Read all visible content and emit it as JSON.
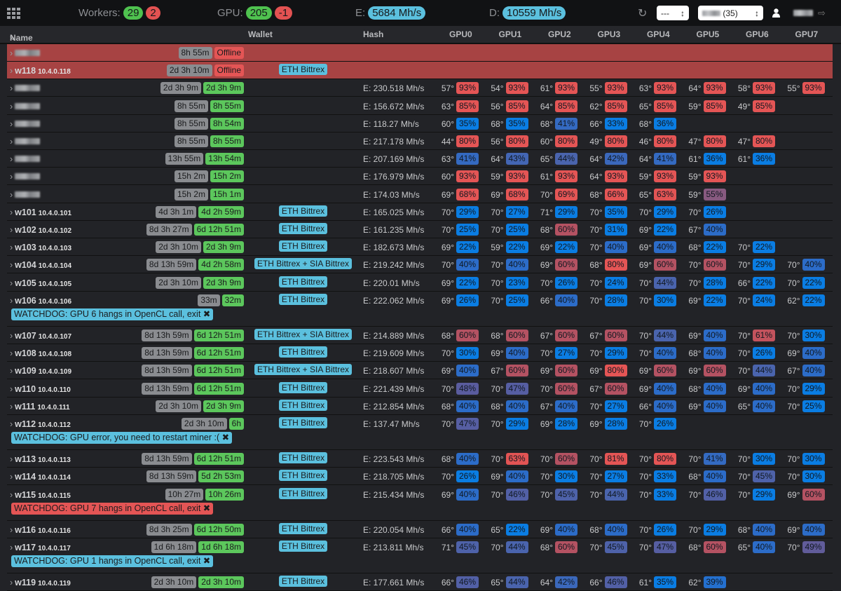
{
  "topbar": {
    "workers_label": "Workers:",
    "workers_ok": "29",
    "workers_bad": "2",
    "gpu_label": "GPU:",
    "gpu_ok": "205",
    "gpu_bad": "-1",
    "e_label": "E:",
    "e_rate": "5684 Mh/s",
    "d_label": "D:",
    "d_rate": "10559 Mh/s",
    "select1": "---",
    "select2": "(35)"
  },
  "columns": {
    "name": "Name",
    "wallet": "Wallet",
    "hash": "Hash",
    "gpus": [
      "GPU0",
      "GPU1",
      "GPU2",
      "GPU3",
      "GPU4",
      "GPU5",
      "GPU6",
      "GPU7"
    ]
  },
  "colors": {
    "offline_row": "#a74343",
    "uptime": "#8a8c90",
    "online": "#5cc75c",
    "offline": "#e45555",
    "wallet": "#5bc0de",
    "fan_low": "#0a7de3",
    "fan_high": "#e45555"
  },
  "rows": [
    {
      "name": "",
      "ip": "",
      "up": "8h 55m",
      "status": "Offline",
      "offline": true,
      "wallet": "",
      "hash": "",
      "gpus": []
    },
    {
      "name": "w118",
      "ip": "10.4.0.118",
      "up": "2d 3h 10m",
      "status": "Offline",
      "offline": true,
      "wallet": "ETH Bittrex",
      "hash": "",
      "gpus": []
    },
    {
      "name": "",
      "ip": "",
      "up": "2d 3h 9m",
      "status": "2d 3h 9m",
      "wallet": "",
      "hash": "E: 230.518 Mh/s",
      "gpus": [
        [
          57,
          93
        ],
        [
          54,
          93
        ],
        [
          61,
          93
        ],
        [
          55,
          93
        ],
        [
          63,
          93
        ],
        [
          64,
          93
        ],
        [
          58,
          93
        ],
        [
          55,
          93
        ]
      ]
    },
    {
      "name": "",
      "ip": "",
      "up": "8h 55m",
      "status": "8h 55m",
      "wallet": "",
      "hash": "E: 156.672 Mh/s",
      "gpus": [
        [
          63,
          85
        ],
        [
          56,
          85
        ],
        [
          64,
          85
        ],
        [
          62,
          85
        ],
        [
          65,
          85
        ],
        [
          59,
          85
        ],
        [
          49,
          85
        ]
      ]
    },
    {
      "name": "",
      "ip": "",
      "up": "8h 55m",
      "status": "8h 54m",
      "wallet": "",
      "hash": "E: 118.27 Mh/s",
      "gpus": [
        [
          60,
          35
        ],
        [
          68,
          35
        ],
        [
          68,
          41
        ],
        [
          66,
          33
        ],
        [
          68,
          36
        ]
      ]
    },
    {
      "name": "",
      "ip": "",
      "up": "8h 55m",
      "status": "8h 55m",
      "wallet": "",
      "hash": "E: 217.178 Mh/s",
      "gpus": [
        [
          44,
          80
        ],
        [
          56,
          80
        ],
        [
          60,
          80
        ],
        [
          49,
          80
        ],
        [
          46,
          80
        ],
        [
          47,
          80
        ],
        [
          47,
          80
        ]
      ]
    },
    {
      "name": "",
      "ip": "",
      "up": "13h 55m",
      "status": "13h 54m",
      "wallet": "",
      "hash": "E: 207.169 Mh/s",
      "gpus": [
        [
          63,
          41
        ],
        [
          64,
          43
        ],
        [
          65,
          44
        ],
        [
          64,
          42
        ],
        [
          64,
          41
        ],
        [
          61,
          36
        ],
        [
          61,
          36
        ]
      ]
    },
    {
      "name": "",
      "ip": "",
      "up": "15h 2m",
      "status": "15h 2m",
      "wallet": "",
      "hash": "E: 176.979 Mh/s",
      "gpus": [
        [
          60,
          93
        ],
        [
          59,
          93
        ],
        [
          61,
          93
        ],
        [
          64,
          93
        ],
        [
          59,
          93
        ],
        [
          59,
          93
        ]
      ]
    },
    {
      "name": "",
      "ip": "",
      "up": "15h 2m",
      "status": "15h 1m",
      "wallet": "",
      "hash": "E: 174.03 Mh/s",
      "gpus": [
        [
          69,
          68
        ],
        [
          69,
          68
        ],
        [
          70,
          69
        ],
        [
          68,
          66
        ],
        [
          65,
          63
        ],
        [
          59,
          55
        ]
      ]
    },
    {
      "name": "w101",
      "ip": "10.4.0.101",
      "up": "4d 3h 1m",
      "status": "4d 2h 59m",
      "wallet": "ETH Bittrex",
      "hash": "E: 165.025 Mh/s",
      "gpus": [
        [
          70,
          29
        ],
        [
          70,
          27
        ],
        [
          71,
          29
        ],
        [
          70,
          35
        ],
        [
          70,
          29
        ],
        [
          70,
          26
        ]
      ]
    },
    {
      "name": "w102",
      "ip": "10.4.0.102",
      "up": "8d 3h 27m",
      "status": "6d 12h 51m",
      "wallet": "ETH Bittrex",
      "hash": "E: 161.235 Mh/s",
      "gpus": [
        [
          70,
          25
        ],
        [
          70,
          25
        ],
        [
          68,
          60
        ],
        [
          70,
          31
        ],
        [
          69,
          22
        ],
        [
          67,
          40
        ]
      ]
    },
    {
      "name": "w103",
      "ip": "10.4.0.103",
      "up": "2d 3h 10m",
      "status": "2d 3h 9m",
      "wallet": "ETH Bittrex",
      "hash": "E: 182.673 Mh/s",
      "gpus": [
        [
          69,
          22
        ],
        [
          59,
          22
        ],
        [
          69,
          22
        ],
        [
          70,
          40
        ],
        [
          69,
          40
        ],
        [
          68,
          22
        ],
        [
          70,
          22
        ]
      ]
    },
    {
      "name": "w104",
      "ip": "10.4.0.104",
      "up": "8d 13h 59m",
      "status": "4d 2h 58m",
      "wallet": "ETH Bittrex + SIA Bittrex",
      "hash": "E: 219.242 Mh/s",
      "gpus": [
        [
          70,
          40
        ],
        [
          70,
          40
        ],
        [
          69,
          60
        ],
        [
          68,
          80
        ],
        [
          69,
          60
        ],
        [
          70,
          60
        ],
        [
          70,
          29
        ],
        [
          70,
          40
        ]
      ]
    },
    {
      "name": "w105",
      "ip": "10.4.0.105",
      "up": "2d 3h 10m",
      "status": "2d 3h 9m",
      "wallet": "ETH Bittrex",
      "hash": "E: 220.01 Mh/s",
      "gpus": [
        [
          69,
          22
        ],
        [
          70,
          23
        ],
        [
          70,
          26
        ],
        [
          70,
          24
        ],
        [
          70,
          44
        ],
        [
          70,
          28
        ],
        [
          66,
          22
        ],
        [
          70,
          22
        ]
      ]
    },
    {
      "name": "w106",
      "ip": "10.4.0.106",
      "up": "33m",
      "status": "32m",
      "wallet": "ETH Bittrex",
      "hash": "E: 222.062 Mh/s",
      "gpus": [
        [
          69,
          26
        ],
        [
          70,
          25
        ],
        [
          66,
          40
        ],
        [
          70,
          28
        ],
        [
          70,
          30
        ],
        [
          69,
          22
        ],
        [
          70,
          24
        ],
        [
          62,
          22
        ]
      ],
      "watchdog": "WATCHDOG: GPU 6 hangs in OpenCL call, exit",
      "watchdog_level": "info"
    },
    {
      "name": "w107",
      "ip": "10.4.0.107",
      "up": "8d 13h 59m",
      "status": "6d 12h 51m",
      "wallet": "ETH Bittrex + SIA Bittrex",
      "hash": "E: 214.889 Mh/s",
      "gpus": [
        [
          68,
          60
        ],
        [
          68,
          60
        ],
        [
          67,
          60
        ],
        [
          67,
          60
        ],
        [
          70,
          44
        ],
        [
          69,
          40
        ],
        [
          70,
          61
        ],
        [
          70,
          30
        ]
      ]
    },
    {
      "name": "w108",
      "ip": "10.4.0.108",
      "up": "8d 13h 59m",
      "status": "6d 12h 51m",
      "wallet": "ETH Bittrex",
      "hash": "E: 219.609 Mh/s",
      "gpus": [
        [
          70,
          30
        ],
        [
          69,
          40
        ],
        [
          70,
          27
        ],
        [
          70,
          29
        ],
        [
          70,
          40
        ],
        [
          68,
          40
        ],
        [
          70,
          26
        ],
        [
          69,
          40
        ]
      ]
    },
    {
      "name": "w109",
      "ip": "10.4.0.109",
      "up": "8d 13h 59m",
      "status": "6d 12h 51m",
      "wallet": "ETH Bittrex + SIA Bittrex",
      "hash": "E: 218.607 Mh/s",
      "gpus": [
        [
          69,
          40
        ],
        [
          67,
          60
        ],
        [
          69,
          60
        ],
        [
          69,
          80
        ],
        [
          69,
          60
        ],
        [
          69,
          60
        ],
        [
          70,
          44
        ],
        [
          67,
          40
        ]
      ]
    },
    {
      "name": "w110",
      "ip": "10.4.0.110",
      "up": "8d 13h 59m",
      "status": "6d 12h 51m",
      "wallet": "ETH Bittrex",
      "hash": "E: 221.439 Mh/s",
      "gpus": [
        [
          70,
          48
        ],
        [
          70,
          47
        ],
        [
          70,
          60
        ],
        [
          67,
          60
        ],
        [
          69,
          40
        ],
        [
          68,
          40
        ],
        [
          69,
          40
        ],
        [
          70,
          29
        ]
      ]
    },
    {
      "name": "w111",
      "ip": "10.4.0.111",
      "up": "2d 3h 10m",
      "status": "2d 3h 9m",
      "wallet": "ETH Bittrex",
      "hash": "E: 212.854 Mh/s",
      "gpus": [
        [
          68,
          40
        ],
        [
          68,
          40
        ],
        [
          67,
          40
        ],
        [
          70,
          27
        ],
        [
          66,
          40
        ],
        [
          69,
          40
        ],
        [
          65,
          40
        ],
        [
          70,
          25
        ]
      ]
    },
    {
      "name": "w112",
      "ip": "10.4.0.112",
      "up": "2d 3h 10m",
      "status": "6h",
      "wallet": "ETH Bittrex",
      "hash": "E: 137.47 Mh/s",
      "gpus": [
        [
          70,
          47
        ],
        [
          70,
          29
        ],
        [
          69,
          28
        ],
        [
          69,
          28
        ],
        [
          70,
          26
        ]
      ],
      "watchdog": "WATCHDOG: GPU error, you need to restart miner :(",
      "watchdog_level": "info"
    },
    {
      "name": "w113",
      "ip": "10.4.0.113",
      "up": "8d 13h 59m",
      "status": "6d 12h 51m",
      "wallet": "ETH Bittrex",
      "hash": "E: 223.543 Mh/s",
      "gpus": [
        [
          68,
          40
        ],
        [
          70,
          63
        ],
        [
          70,
          60
        ],
        [
          70,
          81
        ],
        [
          70,
          80
        ],
        [
          70,
          41
        ],
        [
          70,
          30
        ],
        [
          70,
          30
        ]
      ]
    },
    {
      "name": "w114",
      "ip": "10.4.0.114",
      "up": "8d 13h 59m",
      "status": "5d 2h 53m",
      "wallet": "ETH Bittrex",
      "hash": "E: 218.705 Mh/s",
      "gpus": [
        [
          70,
          26
        ],
        [
          69,
          40
        ],
        [
          70,
          30
        ],
        [
          70,
          27
        ],
        [
          70,
          33
        ],
        [
          68,
          40
        ],
        [
          70,
          45
        ],
        [
          70,
          30
        ]
      ]
    },
    {
      "name": "w115",
      "ip": "10.4.0.115",
      "up": "10h 27m",
      "status": "10h 26m",
      "wallet": "ETH Bittrex",
      "hash": "E: 215.434 Mh/s",
      "gpus": [
        [
          69,
          40
        ],
        [
          70,
          46
        ],
        [
          70,
          45
        ],
        [
          70,
          44
        ],
        [
          70,
          33
        ],
        [
          70,
          46
        ],
        [
          70,
          29
        ],
        [
          69,
          60
        ]
      ],
      "watchdog": "WATCHDOG: GPU 7 hangs in OpenCL call, exit",
      "watchdog_level": "danger"
    },
    {
      "name": "w116",
      "ip": "10.4.0.116",
      "up": "8d 3h 25m",
      "status": "6d 12h 50m",
      "wallet": "ETH Bittrex",
      "hash": "E: 220.054 Mh/s",
      "gpus": [
        [
          66,
          40
        ],
        [
          65,
          22
        ],
        [
          69,
          40
        ],
        [
          68,
          40
        ],
        [
          70,
          26
        ],
        [
          70,
          29
        ],
        [
          68,
          40
        ],
        [
          69,
          40
        ]
      ]
    },
    {
      "name": "w117",
      "ip": "10.4.0.117",
      "up": "1d 6h 18m",
      "status": "1d 6h 18m",
      "wallet": "ETH Bittrex",
      "hash": "E: 213.811 Mh/s",
      "gpus": [
        [
          71,
          45
        ],
        [
          70,
          44
        ],
        [
          68,
          60
        ],
        [
          70,
          45
        ],
        [
          70,
          47
        ],
        [
          68,
          60
        ],
        [
          65,
          40
        ],
        [
          70,
          49
        ]
      ],
      "watchdog": "WATCHDOG: GPU 1 hangs in OpenCL call, exit",
      "watchdog_level": "info"
    },
    {
      "name": "w119",
      "ip": "10.4.0.119",
      "up": "2d 3h 10m",
      "status": "2d 3h 10m",
      "wallet": "ETH Bittrex",
      "hash": "E: 177.661 Mh/s",
      "gpus": [
        [
          66,
          46
        ],
        [
          65,
          44
        ],
        [
          64,
          42
        ],
        [
          66,
          46
        ],
        [
          61,
          35
        ],
        [
          62,
          39
        ]
      ]
    }
  ]
}
